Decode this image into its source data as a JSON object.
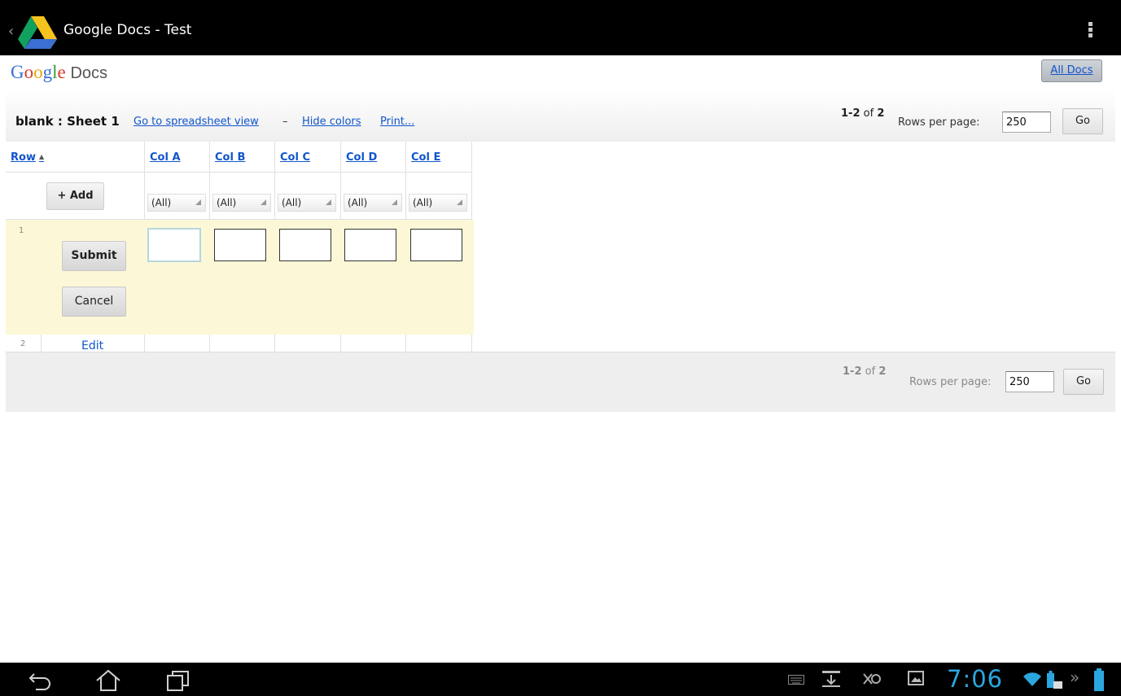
{
  "actionbar": {
    "app_title": "Google Docs - Test",
    "back_icon": "chevron-left-icon",
    "logo_icon": "google-drive-logo",
    "overflow_icon": "overflow-menu-icon"
  },
  "header": {
    "logo": {
      "G": "G",
      "o1": "o",
      "o2": "o",
      "g": "g",
      "l": "l",
      "e": "e",
      "product": "Docs"
    },
    "all_docs_label": "All Docs"
  },
  "titlebar": {
    "sheet_name": "blank : Sheet 1",
    "spreadsheet_view_link": "Go to spreadsheet view",
    "separator": "–",
    "hide_colors_link": "Hide colors",
    "print_link": "Print..."
  },
  "pager_top": {
    "range": "1-2",
    "of_word": "of",
    "total": "2",
    "rows_per_page_label": "Rows per page:",
    "rows_per_page_value": "250",
    "go_label": "Go"
  },
  "pager_bottom": {
    "range": "1-2",
    "of_word": "of",
    "total": "2",
    "rows_per_page_label": "Rows per page:",
    "rows_per_page_value": "250",
    "go_label": "Go"
  },
  "grid": {
    "row_header": "Row",
    "sort_icon": "sort-ascending-icon",
    "columns": [
      "Col A",
      "Col B",
      "Col C",
      "Col D",
      "Col E"
    ],
    "add_label": "+ Add",
    "filter_value": "(All)",
    "row1_number": "1",
    "submit_label": "Submit",
    "cancel_label": "Cancel",
    "row2_number": "2",
    "edit_label": "Edit"
  },
  "systembar": {
    "clock": "7:06",
    "nav_icons": [
      "back-icon",
      "home-icon",
      "recent-apps-icon"
    ],
    "status_icons": [
      "keyboard-icon",
      "download-icon",
      "notification-icon",
      "screenshot-icon",
      "wifi-icon",
      "battery-dock-icon",
      "expand-icon",
      "battery-icon"
    ]
  },
  "colors": {
    "link": "#1155cc",
    "edit_row_bg": "#fcf8d7",
    "clock": "#2aa7df",
    "logo_blue": "#3b6fd1",
    "logo_red": "#d83b2b",
    "logo_yellow": "#e8a90c",
    "logo_green": "#3a9c3a"
  }
}
